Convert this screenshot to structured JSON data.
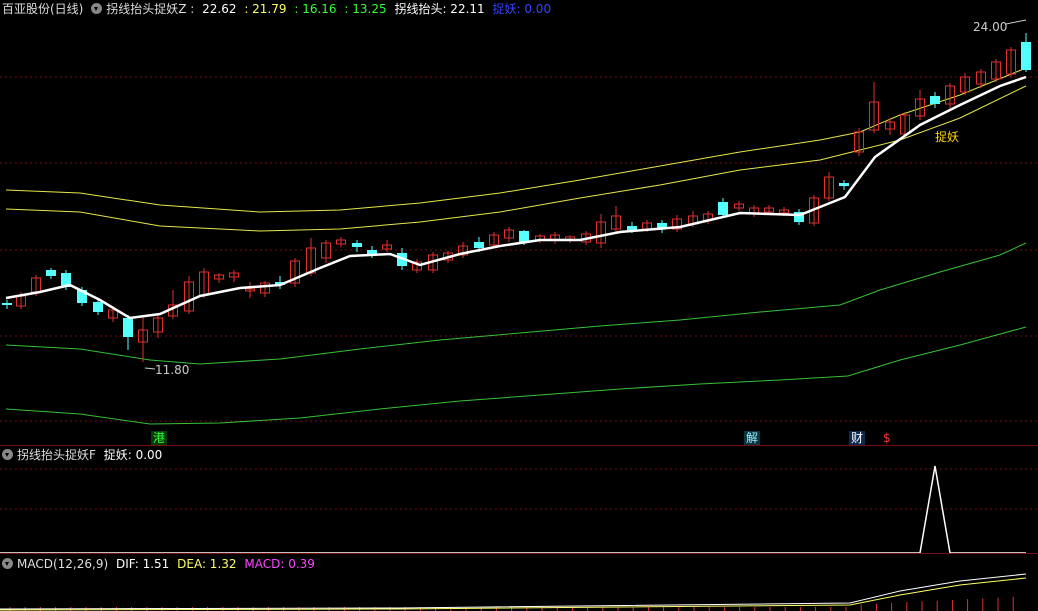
{
  "main": {
    "stock_name": "百亚股份(日线)",
    "indicator_name": "拐线抬头捉妖Z :",
    "values": [
      {
        "text": "22.62",
        "color": "#ffffff"
      },
      {
        "text": ": 21.79",
        "color": "#ffff66"
      },
      {
        "text": ": 16.16",
        "color": "#33ff33"
      },
      {
        "text": ": 13.25",
        "color": "#33ff33"
      }
    ],
    "line_label": "拐线抬头: 22.11",
    "catch_label": "捉妖: 0.00",
    "high_marker": "24.00",
    "low_marker": "11.80",
    "signal_text": "捉妖",
    "tags": [
      {
        "text": "港",
        "bg": "#0a3a0a",
        "fg": "#33ff33"
      },
      {
        "text": "解",
        "bg": "#0a3540",
        "fg": "#9ef"
      },
      {
        "text": "财",
        "bg": "#0a2a50",
        "fg": "#ffffff"
      },
      {
        "text": "$",
        "bg": "#000000",
        "fg": "#ff3333"
      }
    ]
  },
  "indicator": {
    "name": "拐线抬头捉妖F",
    "catch_label": "捉妖: 0.00"
  },
  "macd": {
    "name": "MACD(12,26,9)",
    "dif": "DIF: 1.51",
    "dea": "DEA: 1.32",
    "macd": "MACD: 0.39"
  },
  "colors": {
    "up": "#e03030",
    "down": "#54ffff",
    "ma": "#ffffff",
    "upper_band": "#e6e64a",
    "lower_band": "#36c036",
    "grid": "#7a0d0d"
  }
}
